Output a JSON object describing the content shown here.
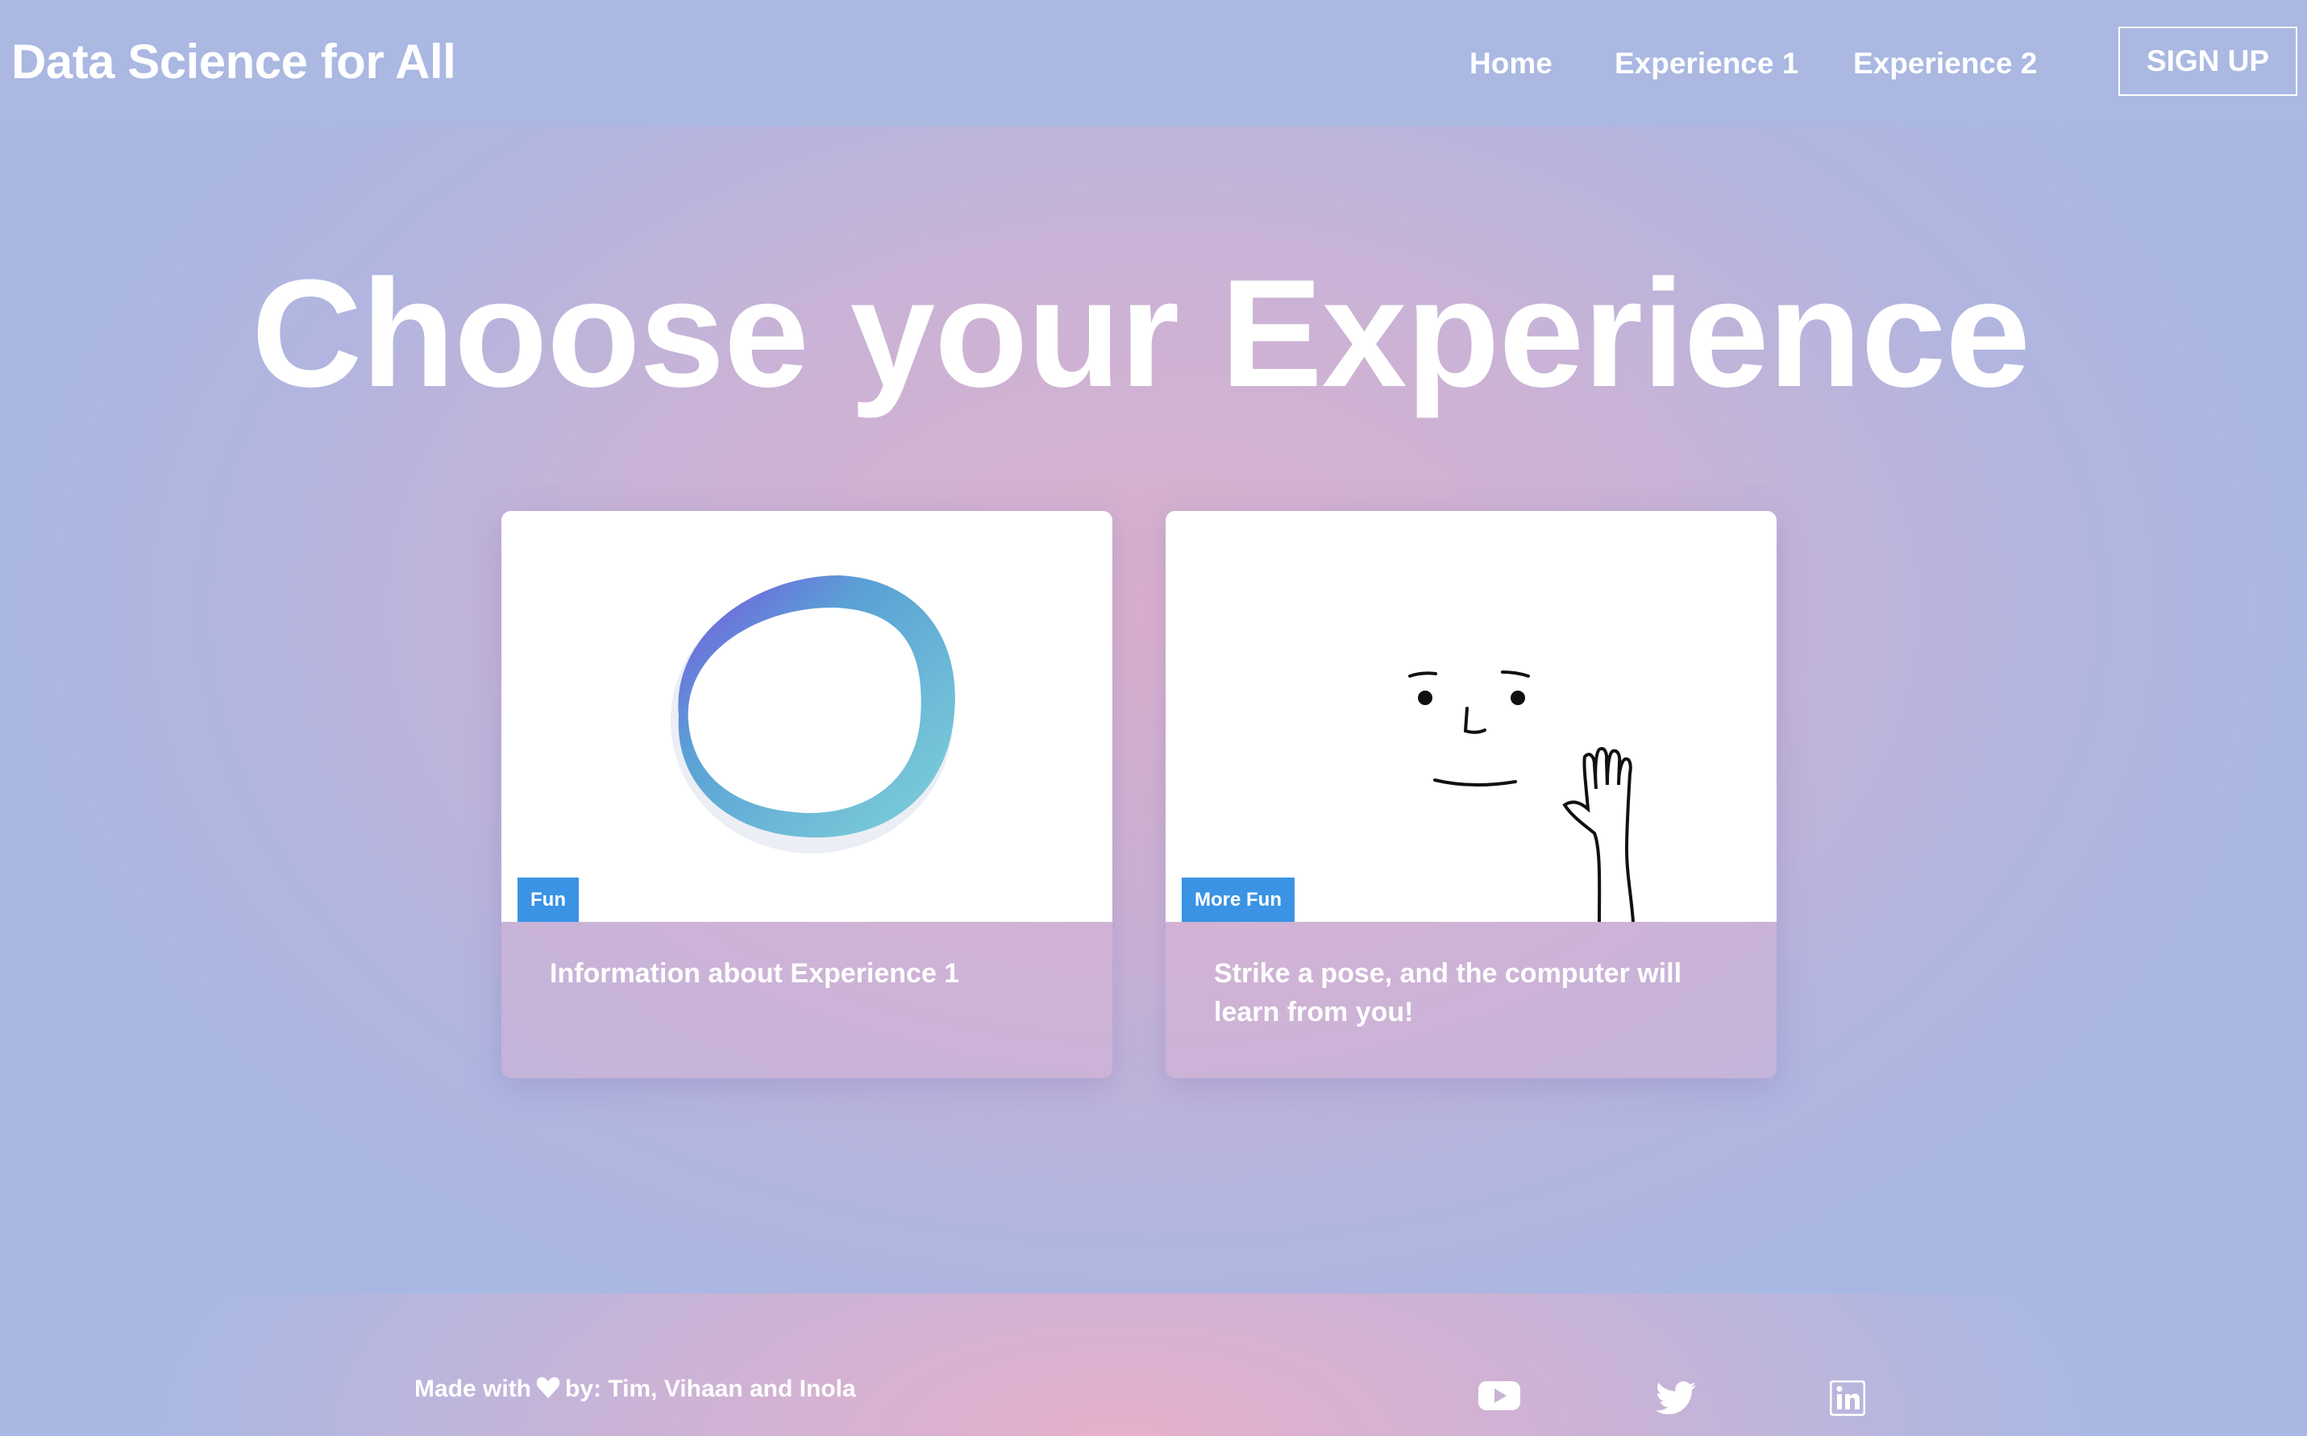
{
  "navbar": {
    "brand": "Data Science for All",
    "links": [
      {
        "label": "Home"
      },
      {
        "label": "Experience 1"
      },
      {
        "label": "Experience 2"
      }
    ],
    "signup_label": "SIGN UP"
  },
  "hero": {
    "title": "Choose your Experience"
  },
  "cards": [
    {
      "tag": "Fun",
      "text": "Information about Experience 1",
      "image_icon": "blob-circle-icon"
    },
    {
      "tag": "More Fun",
      "text": "Strike a pose, and the computer will learn from you!",
      "image_icon": "waving-face-icon"
    }
  ],
  "footer": {
    "made_with": "Made with",
    "heart_icon": "heart-icon",
    "credits": "by: Tim, Vihaan and Inola",
    "social": [
      "youtube-icon",
      "twitter-icon",
      "linkedin-icon"
    ]
  },
  "colors": {
    "navbar_bg": "#aab8e2",
    "tag_bg": "#3a93e4",
    "text": "#ffffff"
  }
}
